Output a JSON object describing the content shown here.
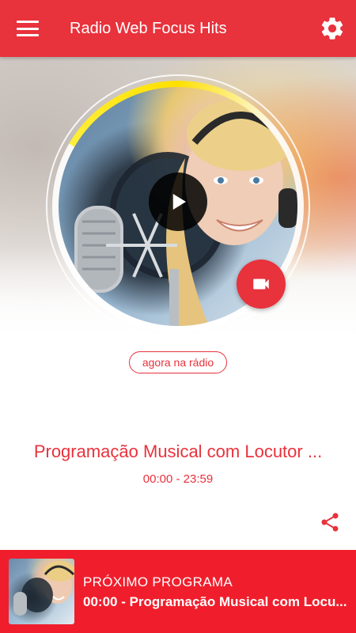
{
  "appbar": {
    "title": "Radio Web Focus Hits",
    "menu_icon": "menu-icon",
    "settings_icon": "gear-icon"
  },
  "colors": {
    "primary": "#e8323c",
    "bottom_bar": "#f01e2c",
    "text_on_primary": "#ffffff"
  },
  "player": {
    "play_icon": "play-icon",
    "video_icon": "video-camera-icon",
    "now_label": "agora na rádio"
  },
  "current_program": {
    "title": "Programação Musical com Locutor ...",
    "time": "00:00 - 23:59",
    "share_icon": "share-icon"
  },
  "next_program": {
    "label": "PRÓXIMO PROGRAMA",
    "title": "00:00 - Programação Musical com Locu..."
  }
}
